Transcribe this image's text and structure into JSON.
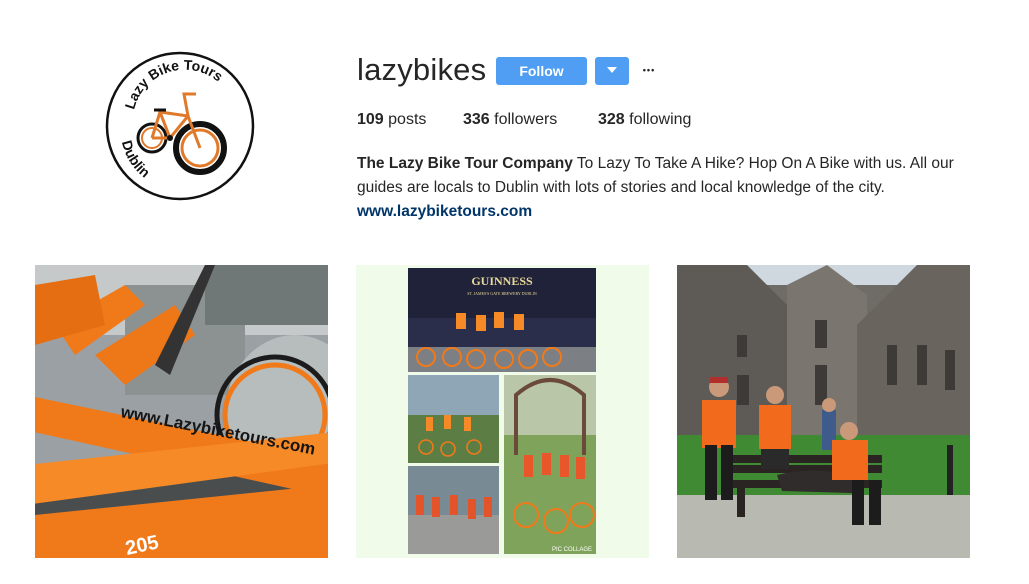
{
  "profile": {
    "username": "lazybikes",
    "follow_label": "Follow",
    "dropdown_icon": "caret-down-icon",
    "more_icon": "ellipsis-icon",
    "more_glyph": "•••",
    "stats": {
      "posts_count": "109",
      "posts_label": "posts",
      "followers_count": "336",
      "followers_label": "followers",
      "following_count": "328",
      "following_label": "following"
    },
    "bio": {
      "name": "The Lazy Bike Tour Company",
      "text": "To Lazy To Take A Hike? Hop On A Bike with us. All our guides are locals to Dublin with lots of stories and local knowledge of the city.",
      "website": "www.lazybiketours.com"
    },
    "avatar": {
      "top_text": "Lazy Bike Tours",
      "bottom_text": "Dublin"
    }
  },
  "posts": [
    {
      "caption_text": "www.Lazybiketours.com",
      "frame_text": "205",
      "subject": "orange bikes close-up"
    },
    {
      "caption_text": "GUINNESS",
      "caption_sub": "ST. JAMES'S GATE BREWERY DUBLIN",
      "footer_text": "PIC COLLAGE",
      "subject": "tour group collage"
    },
    {
      "subject": "tour group at church bench"
    }
  ],
  "colors": {
    "accent": "#4f9ef3",
    "link": "#003569",
    "bike_orange": "#f07a1a"
  }
}
